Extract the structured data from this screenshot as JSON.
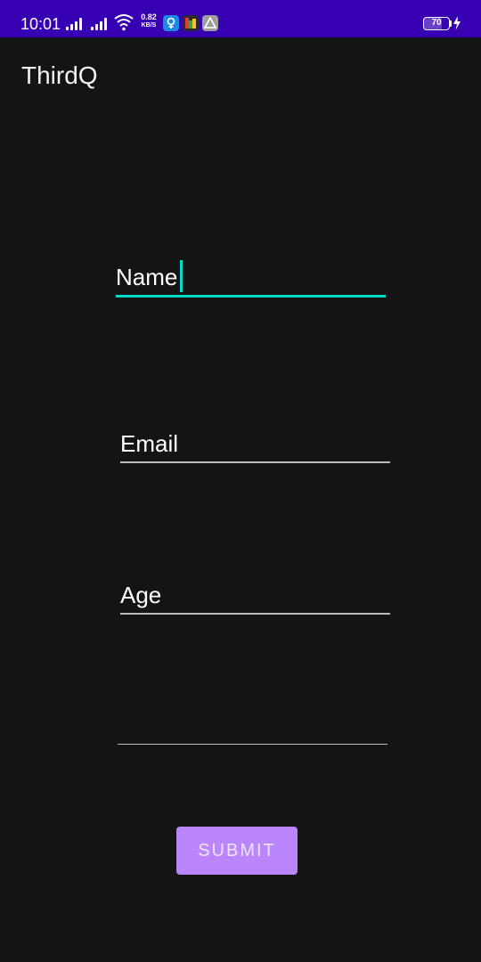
{
  "status_bar": {
    "time": "10:01",
    "net_speed_value": "0.82",
    "net_speed_unit": "KB/S",
    "battery_level": "70",
    "battery_fraction": 0.7,
    "background_color": "#3700b3",
    "icons": [
      "signal-icon",
      "signal-icon",
      "wifi-icon",
      "app-notification-icon",
      "app-notification-icon",
      "app-notification-icon",
      "battery-icon",
      "charging-bolt-icon"
    ]
  },
  "app_bar": {
    "title": "ThirdQ"
  },
  "form": {
    "name": {
      "value": "Name",
      "placeholder": ""
    },
    "email": {
      "value": "",
      "placeholder": "Email"
    },
    "age": {
      "value": "",
      "placeholder": "Age"
    },
    "fourth": {
      "value": "",
      "placeholder": ""
    },
    "submit_label": "SUBMIT"
  },
  "colors": {
    "background": "#141414",
    "accent": "#03dac5",
    "button": "#bb86fc",
    "underline": "#bdbdbd"
  }
}
